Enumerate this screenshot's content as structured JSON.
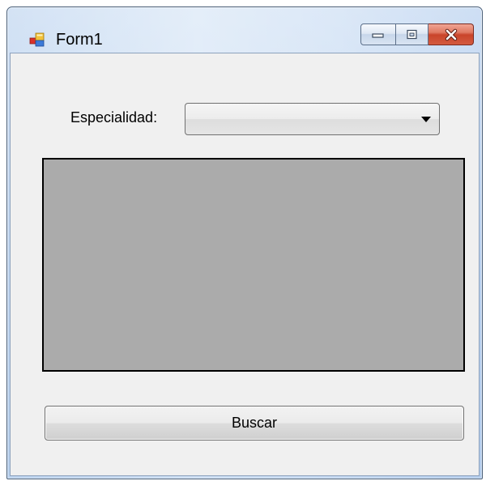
{
  "window": {
    "title": "Form1",
    "icon": "winforms-app-icon",
    "caption_buttons": {
      "minimize": "minimize-icon",
      "maximize": "maximize-icon",
      "close": "close-icon"
    }
  },
  "form": {
    "especialidad_label": "Especialidad:",
    "especialidad_value": "",
    "grid_background": "#ababab",
    "buscar_label": "Buscar"
  },
  "colors": {
    "client_bg": "#f0f0f0",
    "close_button": "#c9442a",
    "title_bar": "#c9dcf3"
  }
}
